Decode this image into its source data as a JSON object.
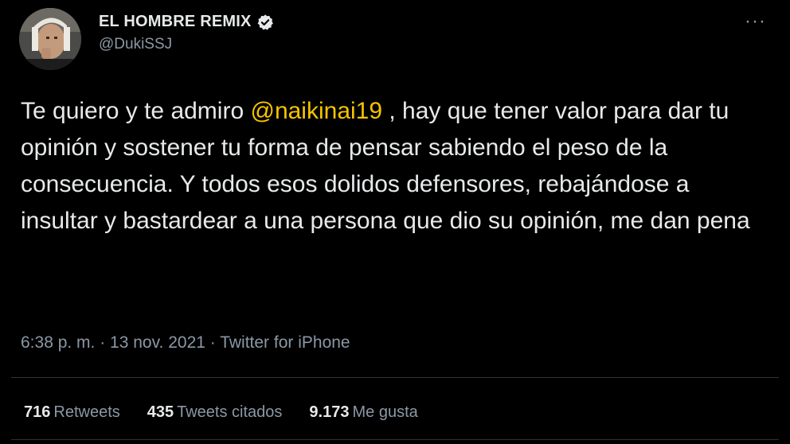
{
  "user": {
    "display_name": "EL HOMBRE REMIX",
    "handle": "@DukiSSJ"
  },
  "tweet": {
    "text_before": "Te quiero y te admiro ",
    "mention": "@naikinai19",
    "text_after": " , hay que tener valor para dar tu opinión y sostener tu forma de pensar sabiendo el peso de la consecuencia. Y todos esos dolidos defensores, rebajándose a insultar y bastardear a una persona que dio su opinión, me dan pena",
    "meta": "6:38 p. m. · 13 nov. 2021 · Twitter for iPhone"
  },
  "stats": [
    {
      "count": "716",
      "label": "Retweets"
    },
    {
      "count": "435",
      "label": "Tweets citados"
    },
    {
      "count": "9.173",
      "label": "Me gusta"
    }
  ],
  "colors": {
    "background": "#000000",
    "text": "#e7e9ea",
    "secondary": "#8b98a5",
    "mention": "#f5c400",
    "divider": "#2f3336"
  },
  "icons": {
    "verified": "verified-badge-icon",
    "more": "more-dots-icon"
  }
}
